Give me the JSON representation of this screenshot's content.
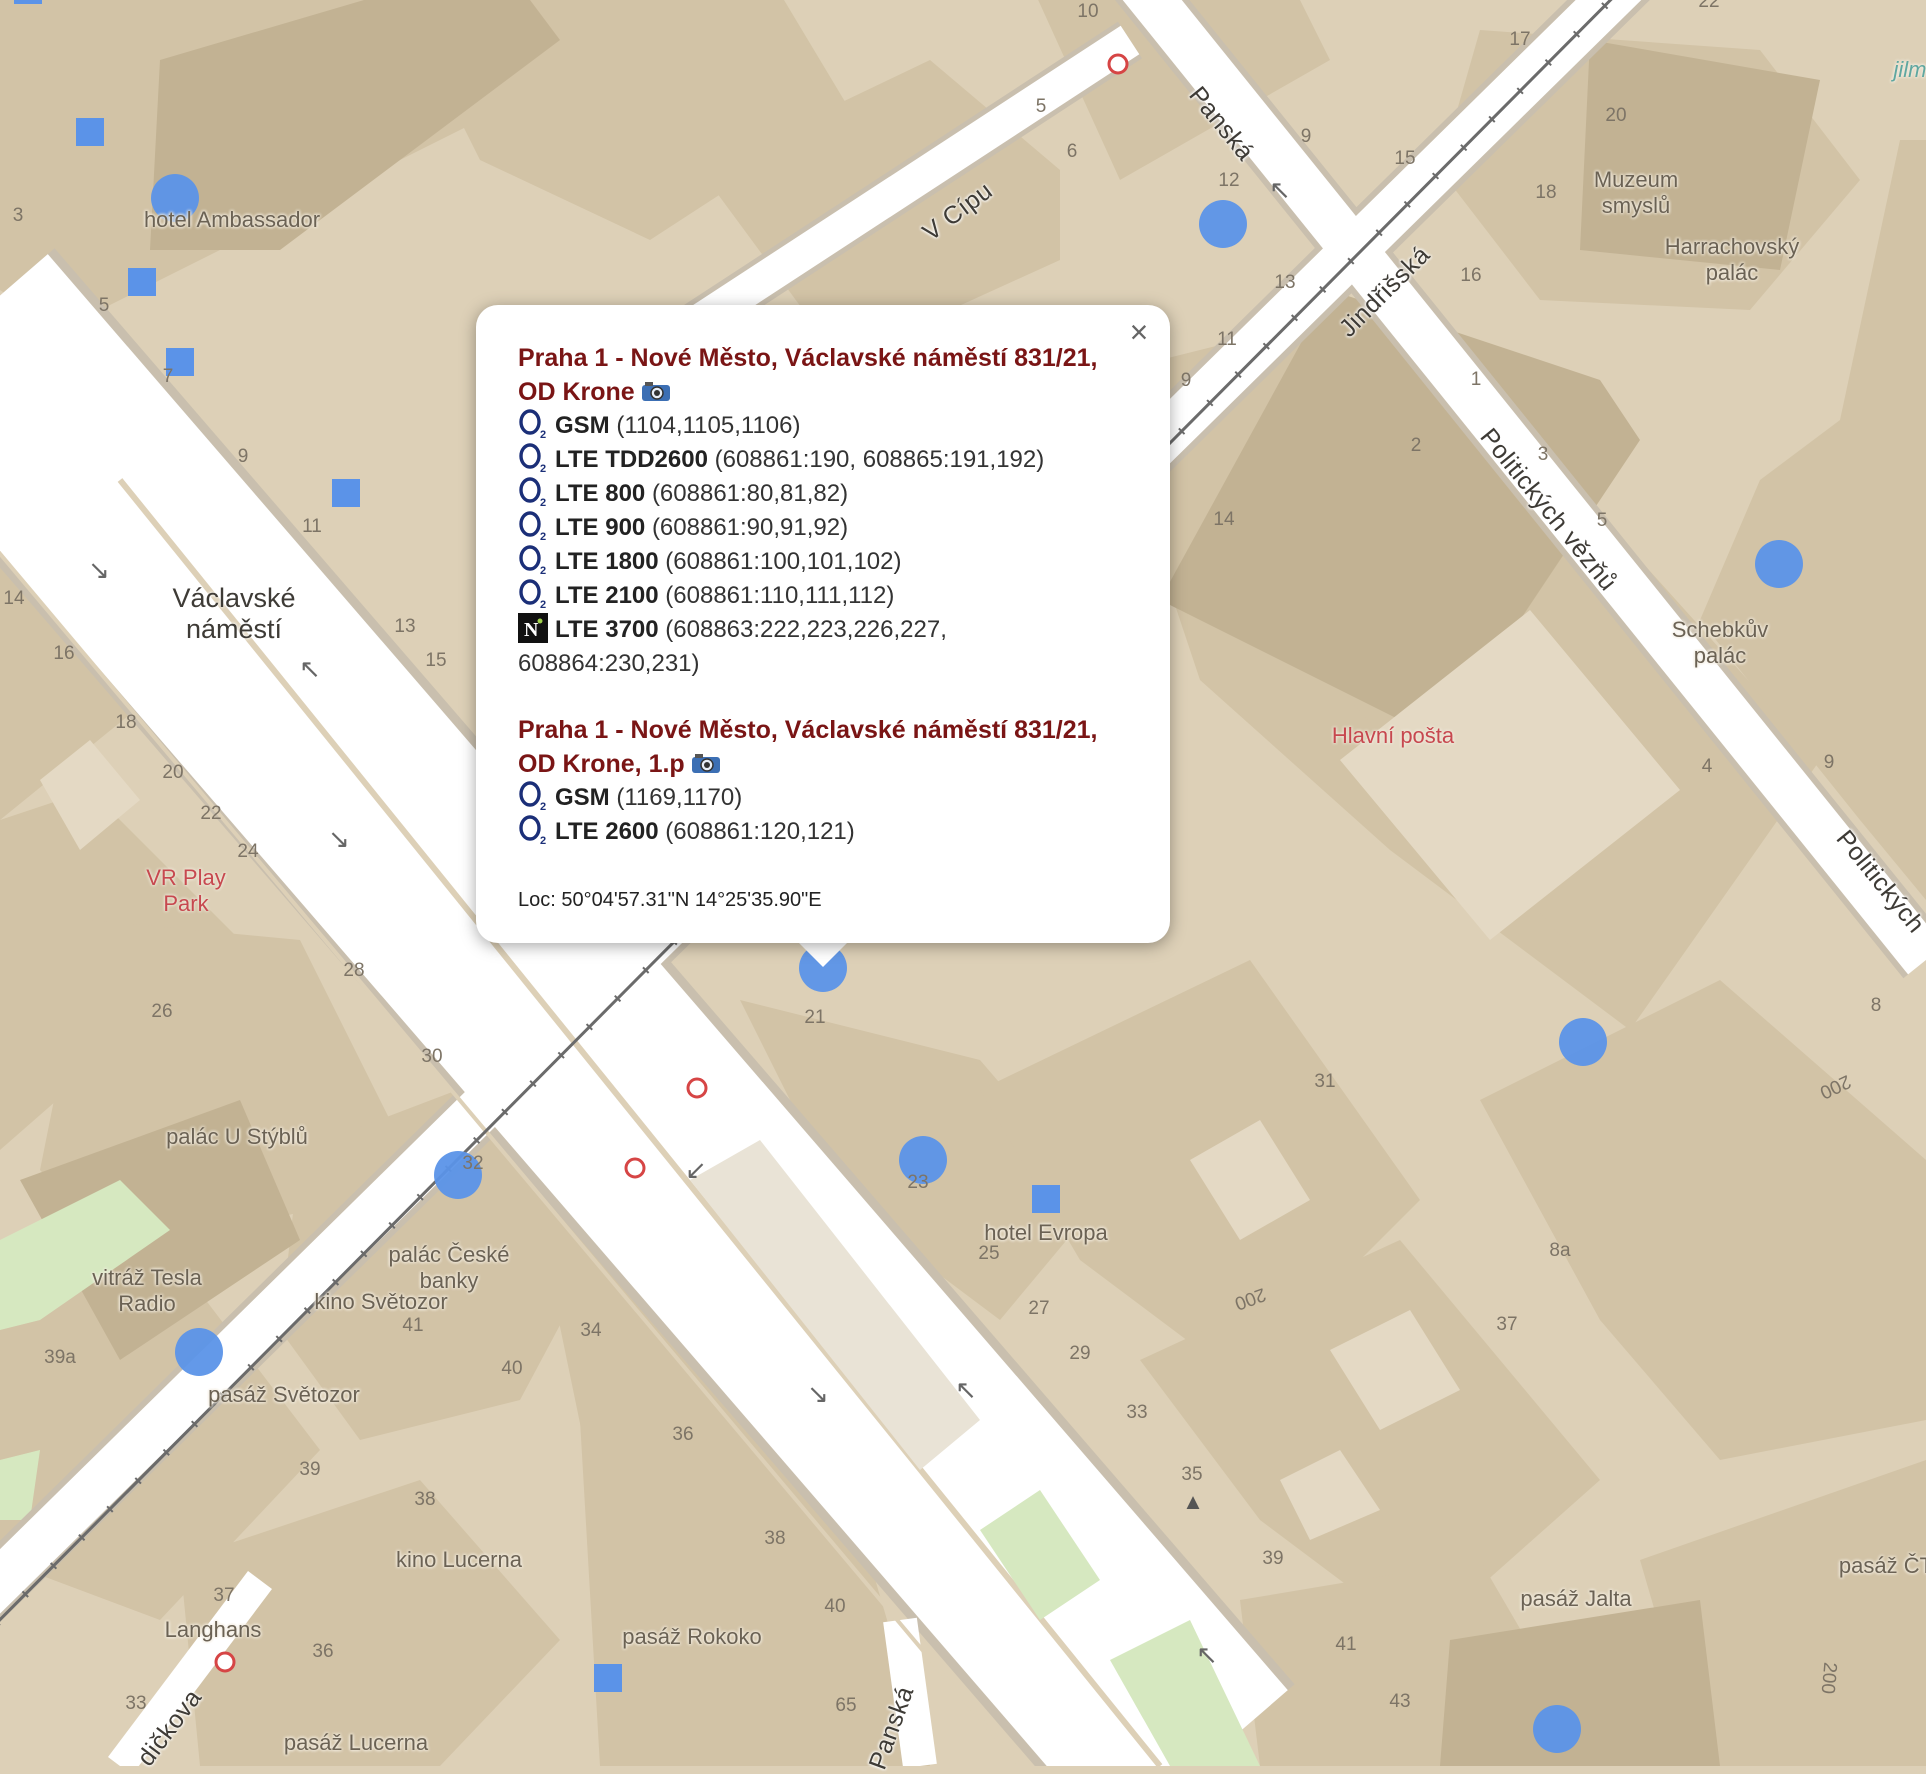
{
  "map": {
    "square_labels": [
      {
        "id": "vaclavske-namesti",
        "text": "Václavské\nnáměstí"
      }
    ],
    "street_labels": [
      {
        "id": "v-cipu",
        "text": "V Cípu"
      },
      {
        "id": "panska",
        "text": "Panská"
      },
      {
        "id": "jindrisska",
        "text": "Jindřišská"
      },
      {
        "id": "politickych-veznu",
        "text": "Politických vězňů"
      },
      {
        "id": "politickych-2",
        "text": "Politických"
      },
      {
        "id": "vodickova",
        "text": "dičkova"
      },
      {
        "id": "panska-2",
        "text": "Panská"
      }
    ],
    "place_labels": [
      {
        "id": "hotel-ambassador",
        "text": "hotel Ambassador"
      },
      {
        "id": "muzeum-smyslu",
        "text": "Muzeum\nsmyslů"
      },
      {
        "id": "harrachovsky-palac",
        "text": "Harrachovský\npalác"
      },
      {
        "id": "schebkuv-palac",
        "text": "Schebkův\npalác"
      },
      {
        "id": "palac-u-stybu",
        "text": "palác U Stýblů"
      },
      {
        "id": "palac-ceske-banky",
        "text": "palác České\nbanky"
      },
      {
        "id": "kino-svetozor",
        "text": "kino Světozor"
      },
      {
        "id": "vitraz-tesla",
        "text": "vitráž Tesla\nRadio"
      },
      {
        "id": "pasaz-svetozor",
        "text": "pasáž Světozor"
      },
      {
        "id": "hotel-evropa",
        "text": "hotel Evropa"
      },
      {
        "id": "kino-lucerna",
        "text": "kino Lucerna"
      },
      {
        "id": "langhans",
        "text": "Langhans"
      },
      {
        "id": "pasaz-rokoko",
        "text": "pasáž Rokoko"
      },
      {
        "id": "pasaz-lucerna",
        "text": "pasáž Lucerna"
      },
      {
        "id": "pasaz-jalta",
        "text": "pasáž Jalta"
      },
      {
        "id": "pasaz-ct",
        "text": "pasáž ČT"
      },
      {
        "id": "jilm",
        "text": "jilm"
      }
    ],
    "poi_labels": [
      {
        "id": "hlavni-posta",
        "text": "Hlavní pošta"
      },
      {
        "id": "vr-play-park",
        "text": "VR Play\nPark"
      }
    ],
    "house_numbers": [
      "10",
      "5",
      "6",
      "12",
      "13",
      "11",
      "9",
      "9",
      "15",
      "20",
      "18",
      "16",
      "17",
      "22",
      "1",
      "2",
      "3",
      "5",
      "4",
      "9",
      "8",
      "14",
      "3",
      "5",
      "7",
      "9",
      "11",
      "13",
      "15",
      "14",
      "16",
      "18",
      "20",
      "22",
      "24",
      "28",
      "26",
      "30",
      "32",
      "21",
      "23",
      "25",
      "27",
      "29",
      "31",
      "33",
      "35",
      "37",
      "39",
      "41",
      "43",
      "8a",
      "200",
      "200",
      "200",
      "39a",
      "34",
      "36",
      "38",
      "40",
      "41",
      "40",
      "36",
      "37",
      "38",
      "39",
      "33",
      "65"
    ],
    "colors": {
      "land": "#ddd0b7",
      "building": "#d2c3a6",
      "building_dark": "#c2b293",
      "road": "#ffffff",
      "road_casing": "#c9bfae",
      "park": "#d6e8c0",
      "tram": "#6b6b6b",
      "marker": "#5b93e8",
      "stop": "#d64545"
    }
  },
  "popup": {
    "close_label": "×",
    "sites": [
      {
        "title": "Praha 1 - Nové Město, Václavské náměstí 831/21, OD Krone",
        "cells": [
          {
            "operator": "o2-logo",
            "tech": "GSM",
            "ids": "(1104,1105,1106)"
          },
          {
            "operator": "o2-logo",
            "tech": "LTE TDD2600",
            "ids": "(608861:190, 608865:191,192)"
          },
          {
            "operator": "o2-logo",
            "tech": "LTE 800",
            "ids": "(608861:80,81,82)"
          },
          {
            "operator": "o2-logo",
            "tech": "LTE 900",
            "ids": "(608861:90,91,92)"
          },
          {
            "operator": "o2-logo",
            "tech": "LTE 1800",
            "ids": "(608861:100,101,102)"
          },
          {
            "operator": "o2-logo",
            "tech": "LTE 2100",
            "ids": "(608861:110,111,112)"
          },
          {
            "operator": "nordic-telecom-logo",
            "tech": "LTE 3700",
            "ids": "(608863:222,223,226,227, 608864:230,231)"
          }
        ]
      },
      {
        "title": "Praha 1 - Nové Město, Václavské náměstí 831/21, OD Krone, 1.p",
        "cells": [
          {
            "operator": "o2-logo",
            "tech": "GSM",
            "ids": "(1169,1170)"
          },
          {
            "operator": "o2-logo",
            "tech": "LTE 2600",
            "ids": "(608861:120,121)"
          }
        ]
      }
    ],
    "location": "Loc: 50°04'57.31\"N 14°25'35.90\"E"
  }
}
